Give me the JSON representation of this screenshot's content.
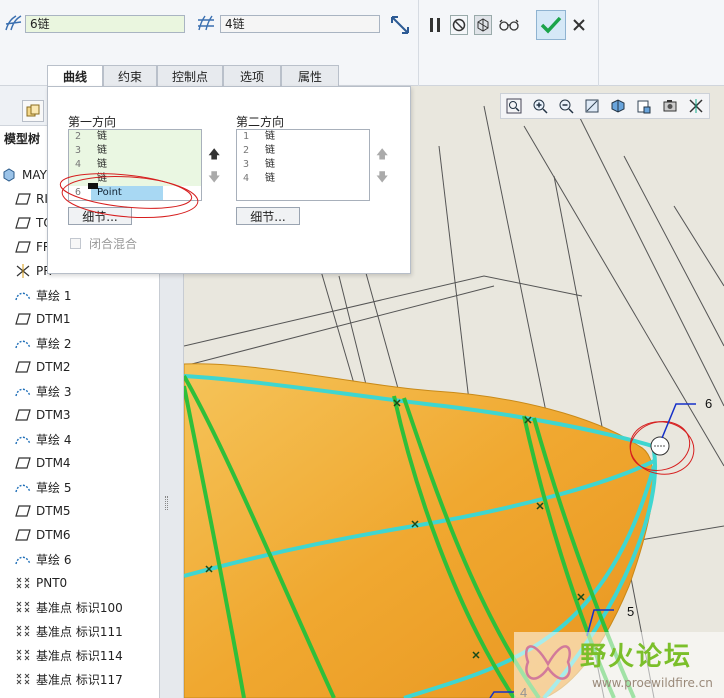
{
  "dashboard": {
    "first_direction_value": "6链",
    "second_direction_value": "4链"
  },
  "tabs": [
    {
      "label": "曲线",
      "active": true
    },
    {
      "label": "约束",
      "active": false
    },
    {
      "label": "控制点",
      "active": false
    },
    {
      "label": "选项",
      "active": false
    },
    {
      "label": "属性",
      "active": false
    }
  ],
  "curves_panel": {
    "first_direction": {
      "title": "第一方向",
      "rows": [
        {
          "num": "2",
          "label": "链"
        },
        {
          "num": "3",
          "label": "链"
        },
        {
          "num": "4",
          "label": "链"
        },
        {
          "num": "",
          "label": "链"
        },
        {
          "num": "6",
          "label": "Point"
        }
      ],
      "details_label": "细节..."
    },
    "second_direction": {
      "title": "第二方向",
      "rows": [
        {
          "num": "1",
          "label": "链"
        },
        {
          "num": "2",
          "label": "链"
        },
        {
          "num": "3",
          "label": "链"
        },
        {
          "num": "4",
          "label": "链"
        }
      ],
      "details_label": "细节..."
    },
    "closed_blend_label": "闭合混合"
  },
  "model_tree": {
    "header": "模型树",
    "items": [
      {
        "icon": "part-icon",
        "label": "MAYI"
      },
      {
        "icon": "datum-plane-icon",
        "label": "RI"
      },
      {
        "icon": "datum-plane-icon",
        "label": "TO"
      },
      {
        "icon": "datum-plane-icon",
        "label": "FR"
      },
      {
        "icon": "csys-icon",
        "label": "PR"
      },
      {
        "icon": "sketch-icon",
        "label": "草绘 1"
      },
      {
        "icon": "datum-plane-icon",
        "label": "DTM1"
      },
      {
        "icon": "sketch-icon",
        "label": "草绘 2"
      },
      {
        "icon": "datum-plane-icon",
        "label": "DTM2"
      },
      {
        "icon": "sketch-icon",
        "label": "草绘 3"
      },
      {
        "icon": "datum-plane-icon",
        "label": "DTM3"
      },
      {
        "icon": "sketch-icon",
        "label": "草绘 4"
      },
      {
        "icon": "datum-plane-icon",
        "label": "DTM4"
      },
      {
        "icon": "sketch-icon",
        "label": "草绘 5"
      },
      {
        "icon": "datum-plane-icon",
        "label": "DTM5"
      },
      {
        "icon": "datum-plane-icon",
        "label": "DTM6"
      },
      {
        "icon": "sketch-icon",
        "label": "草绘 6"
      },
      {
        "icon": "datum-point-icon",
        "label": "PNT0"
      },
      {
        "icon": "datum-point-icon",
        "label": "基准点 标识100"
      },
      {
        "icon": "datum-point-icon",
        "label": "基准点 标识111"
      },
      {
        "icon": "datum-point-icon",
        "label": "基准点 标识114"
      },
      {
        "icon": "datum-point-icon",
        "label": "基准点 标识117"
      }
    ]
  },
  "graphics": {
    "callouts": {
      "c6": "6",
      "c5": "5",
      "c4": "4"
    }
  },
  "watermark": {
    "title": "野火论坛",
    "url": "www.proewildfire.cn"
  },
  "colors": {
    "chain_green": "#2fbf3a",
    "chain_cyan": "#3fd6d0",
    "surface_orange": "#f2b23a",
    "highlight_blue": "#a8d8f3",
    "annotation_red": "#d61f1f"
  }
}
